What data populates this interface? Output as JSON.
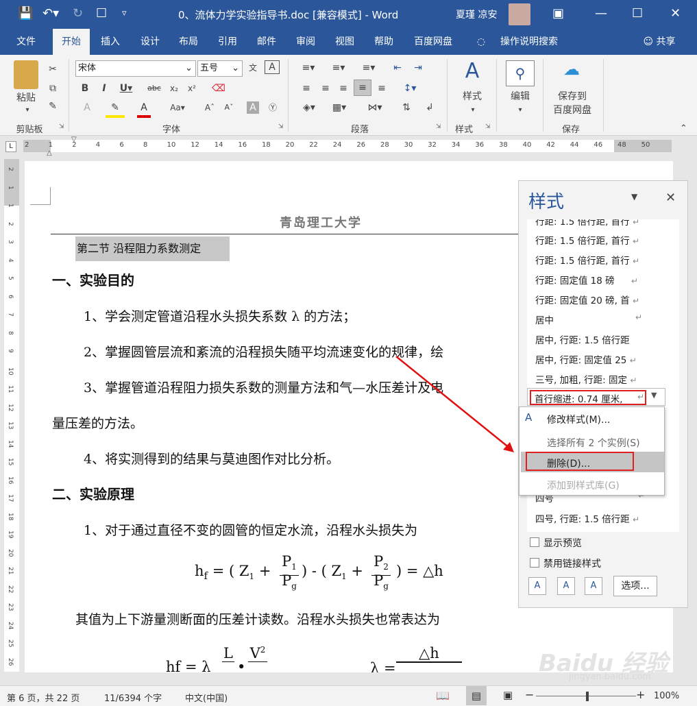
{
  "titlebar": {
    "doc_title": "0、流体力学实验指导书.doc [兼容模式] - Word",
    "user_name": "夏瑾 凉安"
  },
  "tabs": [
    "文件",
    "开始",
    "插入",
    "设计",
    "布局",
    "引用",
    "邮件",
    "审阅",
    "视图",
    "帮助",
    "百度网盘"
  ],
  "tell_me": "操作说明搜索",
  "share": "共享",
  "ribbon": {
    "paste": "粘贴",
    "font_name": "宋体",
    "font_size": "五号",
    "styles_btn": "样式",
    "edit_btn": "编辑",
    "save_btn_1": "保存到",
    "save_btn_2": "百度网盘",
    "groups": {
      "clipboard": "剪贴板",
      "font": "字体",
      "paragraph": "段落",
      "styles": "样式",
      "save": "保存"
    },
    "accent_color": "#2b579a"
  },
  "ruler": {
    "labels": [
      "2",
      "1",
      "2",
      "4",
      "6",
      "8",
      "10",
      "12",
      "14",
      "16",
      "18",
      "20",
      "22",
      "24",
      "26",
      "28",
      "30",
      "32",
      "34",
      "36",
      "38",
      "40",
      "42",
      "44",
      "46",
      "48",
      "50"
    ]
  },
  "document": {
    "header": "青岛理工大学",
    "section": "第二节   沿程阻力系数测定",
    "h1": "一、实验目的",
    "p1": "1、学会测定管道沿程水头损失系数 λ 的方法；",
    "p2": "2、掌握圆管层流和紊流的沿程损失随平均流速变化的规律，绘",
    "p3": "3、掌握管道沿程阻力损失系数的测量方法和气—水压差计及电",
    "p3b": "量压差的方法。",
    "p4": "4、将实测得到的结果与莫迪图作对比分析。",
    "h2": "二、实验原理",
    "p5": "1、对于通过直径不变的圆管的恒定水流，沿程水头损失为",
    "formula1": "hf = ( Z1 + P1/Pg ) - ( Z1 + P2/Pg ) = △h",
    "p6": "其值为上下游量测断面的压差计读数。沿程水头损失也常表达为"
  },
  "styles_pane": {
    "title": "样式",
    "items": [
      "行距: 1.5 倍行距, 首行",
      "行距: 1.5 倍行距, 首行",
      "行距: 1.5 倍行距, 首行",
      "行距: 固定值 18 磅",
      "行距: 固定值 20 磅, 首",
      "居中",
      "居中, 行距: 1.5 倍行距",
      "居中, 行距: 固定值 25",
      "三号, 加粗, 行距: 固定",
      "首行缩进:  0.74 厘米,",
      "四号",
      "四号, 行距: 1.5 倍行距"
    ],
    "show_preview": "显示预览",
    "disable_linked": "禁用链接样式",
    "options": "选项..."
  },
  "context_menu": {
    "modify": "修改样式(M)...",
    "select_all": "选择所有 2 个实例(S)",
    "delete": "删除(D)...",
    "add_gallery": "添加到样式库(G)"
  },
  "statusbar": {
    "page": "第 6 页，共 22 页",
    "words": "11/6394 个字",
    "language": "中文(中国)",
    "zoom": "100%"
  },
  "watermark": "Baidu 经验",
  "watermark_url": "jingyan.baidu.com"
}
